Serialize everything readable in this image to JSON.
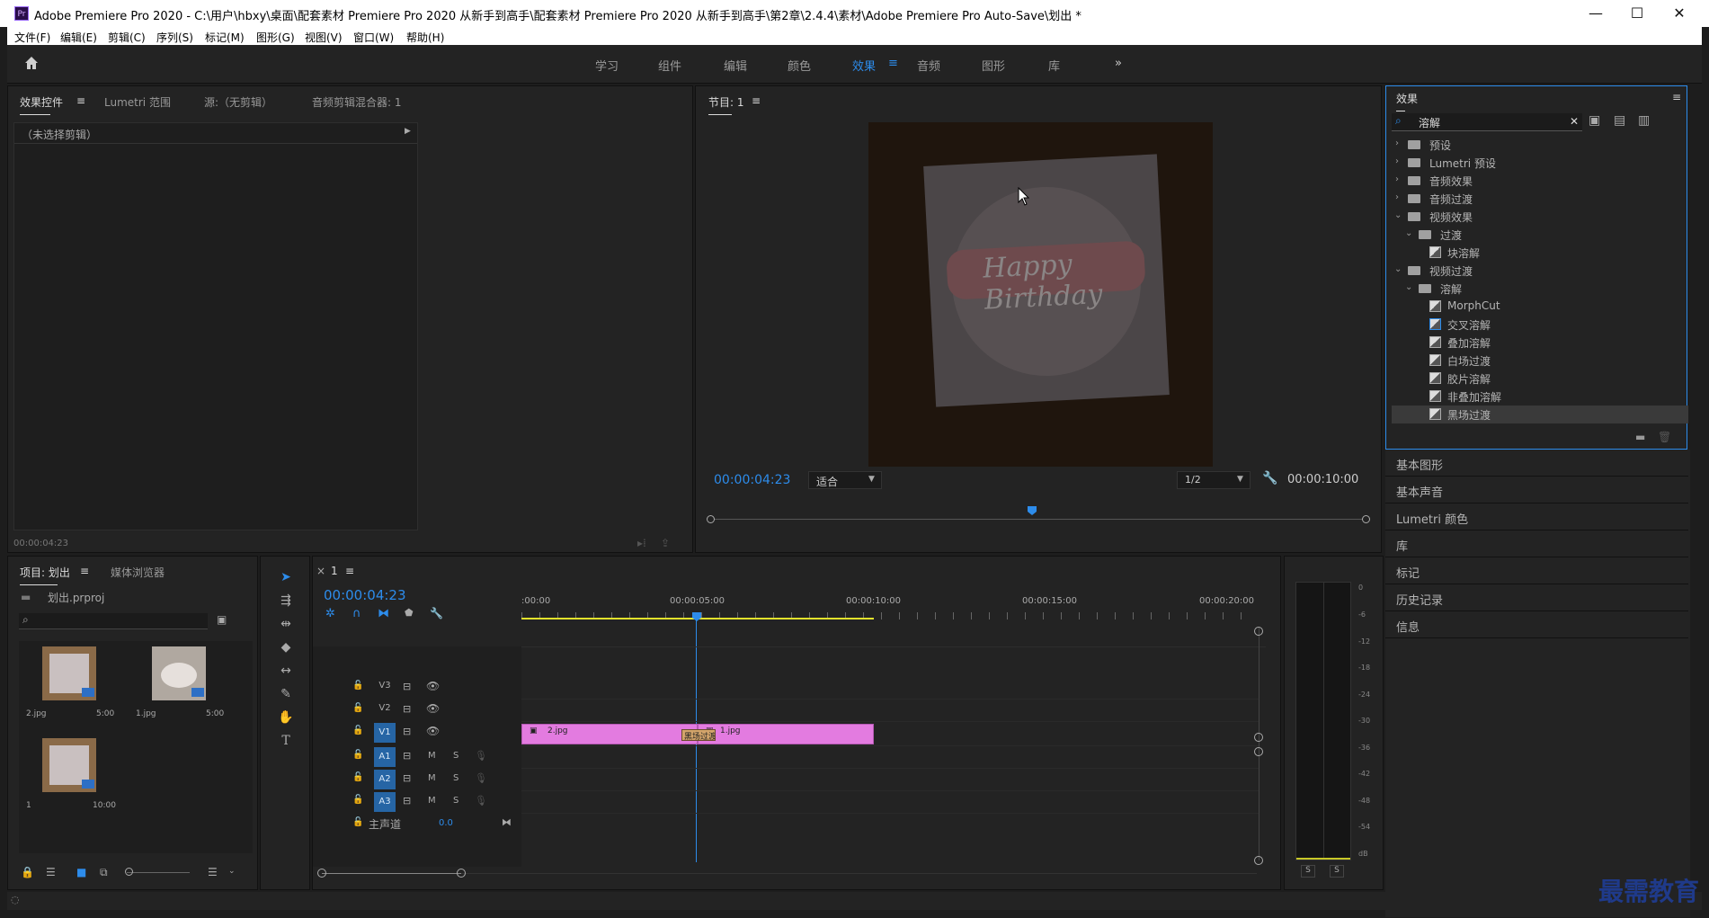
{
  "titlebar": {
    "app_icon": "Pr",
    "title": "Adobe Premiere Pro 2020 - C:\\用户\\hbxy\\桌面\\配套素材 Premiere Pro 2020 从新手到高手\\配套素材 Premiere Pro 2020 从新手到高手\\第2章\\2.4.4\\素材\\Adobe Premiere Pro Auto-Save\\划出 *",
    "minimize": "—",
    "maximize": "☐",
    "close": "✕"
  },
  "menubar": [
    "文件(F)",
    "编辑(E)",
    "剪辑(C)",
    "序列(S)",
    "标记(M)",
    "图形(G)",
    "视图(V)",
    "窗口(W)",
    "帮助(H)"
  ],
  "workspace": {
    "items": [
      "学习",
      "组件",
      "编辑",
      "颜色",
      "效果",
      "音频",
      "图形",
      "库"
    ],
    "active": "效果",
    "more": "»"
  },
  "source_panel": {
    "tabs": [
      "效果控件",
      "Lumetri 范围",
      "源:（无剪辑）",
      "音频剪辑混合器: 1"
    ],
    "no_clip": "（未选择剪辑）",
    "timecode": "00:00:04:23"
  },
  "program_monitor": {
    "tab": "节目: 1",
    "timecode": "00:00:04:23",
    "fit": "适合",
    "quality": "1/2",
    "duration": "00:00:10:00",
    "image_text": "Happy Birthday"
  },
  "effects_panel": {
    "title": "效果",
    "search_value": "溶解",
    "tree": [
      {
        "label": "预设",
        "level": 0,
        "kind": "folder",
        "open": false
      },
      {
        "label": "Lumetri 预设",
        "level": 0,
        "kind": "folder",
        "open": false
      },
      {
        "label": "音频效果",
        "level": 0,
        "kind": "folder",
        "open": false
      },
      {
        "label": "音频过渡",
        "level": 0,
        "kind": "folder",
        "open": false
      },
      {
        "label": "视频效果",
        "level": 0,
        "kind": "folder",
        "open": true
      },
      {
        "label": "过渡",
        "level": 1,
        "kind": "folder",
        "open": true
      },
      {
        "label": "块溶解",
        "level": 2,
        "kind": "effect"
      },
      {
        "label": "视频过渡",
        "level": 0,
        "kind": "folder",
        "open": true
      },
      {
        "label": "溶解",
        "level": 1,
        "kind": "folder",
        "open": true
      },
      {
        "label": "MorphCut",
        "level": 2,
        "kind": "effect"
      },
      {
        "label": "交叉溶解",
        "level": 2,
        "kind": "effect"
      },
      {
        "label": "叠加溶解",
        "level": 2,
        "kind": "effect"
      },
      {
        "label": "白场过渡",
        "level": 2,
        "kind": "effect"
      },
      {
        "label": "胶片溶解",
        "level": 2,
        "kind": "effect"
      },
      {
        "label": "非叠加溶解",
        "level": 2,
        "kind": "effect"
      },
      {
        "label": "黑场过渡",
        "level": 2,
        "kind": "effect",
        "selected": true
      }
    ],
    "collapsed_panels": [
      "基本图形",
      "基本声音",
      "Lumetri 颜色",
      "库",
      "标记",
      "历史记录",
      "信息"
    ]
  },
  "project_panel": {
    "tabs": [
      "项目: 划出",
      "媒体浏览器"
    ],
    "project_file": "划出.prproj",
    "items": [
      {
        "name": "2.jpg",
        "duration": "5:00"
      },
      {
        "name": "1.jpg",
        "duration": "5:00"
      },
      {
        "name": "1",
        "duration": "10:00"
      }
    ]
  },
  "timeline": {
    "tab": "1",
    "timecode": "00:00:04:23",
    "ruler": [
      ":00:00",
      "00:00:05:00",
      "00:00:10:00",
      "00:00:15:00",
      "00:00:20:00"
    ],
    "tracks": [
      {
        "name": "V3",
        "type": "video"
      },
      {
        "name": "V2",
        "type": "video"
      },
      {
        "name": "V1",
        "type": "video",
        "active": true
      },
      {
        "name": "A1",
        "type": "audio",
        "active": true
      },
      {
        "name": "A2",
        "type": "audio",
        "active": true
      },
      {
        "name": "A3",
        "type": "audio",
        "active": true
      }
    ],
    "master": {
      "label": "主声道",
      "value": "0.0"
    },
    "clips": [
      {
        "name": "2.jpg",
        "track": "V1"
      },
      {
        "name": "1.jpg",
        "track": "V1"
      }
    ],
    "transition_label": "黑场过渡",
    "track_buttons": {
      "mute": "M",
      "solo": "S"
    }
  },
  "audio_meter": {
    "scale": [
      "0",
      "-6",
      "-12",
      "-18",
      "-24",
      "-30",
      "-36",
      "-42",
      "-48",
      "-54",
      "dB"
    ],
    "solo_labels": [
      "S",
      "S"
    ]
  },
  "watermark": "最需教育",
  "colors": {
    "accent_blue": "#2d8ceb",
    "clip_pink": "#e37be0",
    "panel_bg": "#232323",
    "selected_row": "#3a3a3a"
  }
}
